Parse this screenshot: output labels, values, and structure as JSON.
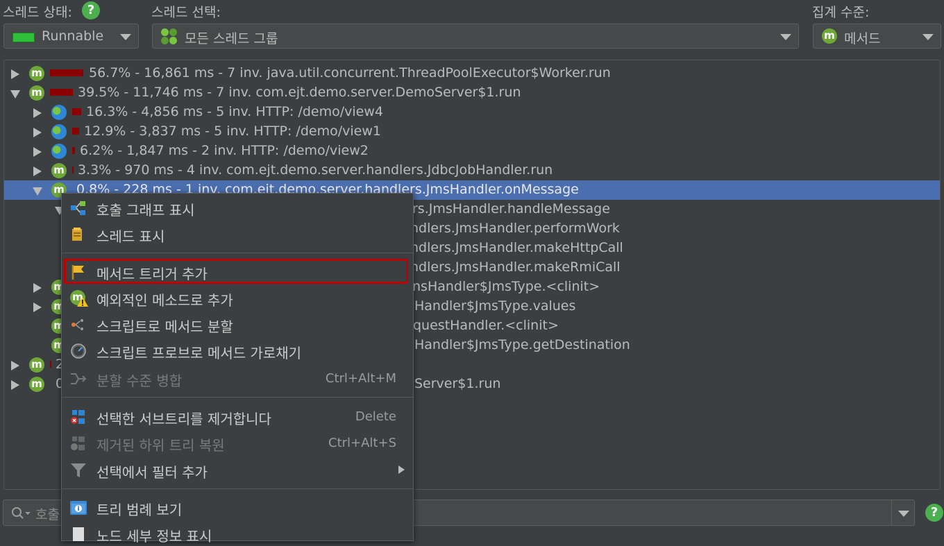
{
  "header": {
    "thread_state_label": "스레드 상태:",
    "thread_state_value": "Runnable",
    "thread_select_label": "스레드 선택:",
    "thread_select_value": "모든 스레드 그룹",
    "aggregation_label": "집계 수준:",
    "aggregation_value": "메서드",
    "help_glyph": "?"
  },
  "colors": {
    "accent_selection": "#4b6eaf",
    "bar": "#8b0000",
    "highlight_border": "#c00000",
    "method_icon": "#6fa839"
  },
  "tree": [
    {
      "text": "56.7% - 16,861 ms - 7 inv. java.util.concurrent.ThreadPoolExecutor$Worker.run",
      "icon": "method-icon",
      "state": "collapsed",
      "share": 0.567
    },
    {
      "text": "39.5% - 11,746 ms - 7 inv. com.ejt.demo.server.DemoServer$1.run",
      "icon": "method-icon",
      "state": "expanded",
      "share": 0.395
    },
    {
      "text": "16.3% - 4,856 ms - 5 inv. HTTP: /demo/view4",
      "icon": "globe-icon",
      "state": "collapsed",
      "share": 0.163
    },
    {
      "text": "12.9% - 3,837 ms - 5 inv. HTTP: /demo/view1",
      "icon": "globe-icon",
      "state": "collapsed",
      "share": 0.129
    },
    {
      "text": "6.2% - 1,847 ms - 2 inv. HTTP: /demo/view2",
      "icon": "globe-icon",
      "state": "collapsed",
      "share": 0.062
    },
    {
      "text": "3.3% - 970 ms - 4 inv. com.ejt.demo.server.handlers.JdbcJobHandler.run",
      "icon": "method-icon",
      "state": "collapsed",
      "share": 0.033
    },
    {
      "text": "0.8% - 228 ms - 1 inv. com.ejt.demo.server.handlers.JmsHandler.onMessage",
      "icon": "method-icon",
      "state": "expanded",
      "share": 0.008
    },
    {
      "text": "rs.JmsHandler.handleMessage",
      "icon": "method-icon",
      "state": "expanded"
    },
    {
      "text": "ndlers.JmsHandler.performWork",
      "icon": "method-icon",
      "state": "none"
    },
    {
      "text": "ndlers.JmsHandler.makeHttpCall",
      "icon": "method-icon",
      "state": "none"
    },
    {
      "text": "ndlers.JmsHandler.makeRmiCall",
      "icon": "method-icon",
      "state": "none"
    },
    {
      "text": "nsHandler$JmsType.<clinit>",
      "icon": "method-icon",
      "state": "collapsed"
    },
    {
      "text": "Handler$JmsType.values",
      "icon": "method-icon",
      "state": "collapsed"
    },
    {
      "text": "questHandler.<clinit>",
      "icon": "method-icon",
      "state": "none"
    },
    {
      "text": "Handler$JmsType.getDestination",
      "icon": "method-icon",
      "state": "none"
    },
    {
      "text": "2",
      "icon": "method-icon",
      "state": "collapsed"
    },
    {
      "text": "0",
      "tail": "Server$1.run",
      "icon": "method-icon",
      "state": "collapsed"
    }
  ],
  "context_menu": [
    {
      "label": "호출 그래프 표시",
      "icon": "call-graph-icon"
    },
    {
      "label": "스레드 표시",
      "icon": "thread-icon"
    },
    {
      "label": "메서드 트리거 추가",
      "icon": "flag-icon",
      "highlighted": true
    },
    {
      "label": "예외적인 메소드로 추가",
      "icon": "method-warning-icon"
    },
    {
      "label": "스크립트로 메서드 분할",
      "icon": "split-icon"
    },
    {
      "label": "스크립트 프로브로 메서드 가로채기",
      "icon": "probe-icon"
    },
    {
      "label": "분할 수준 병합",
      "icon": "merge-icon",
      "shortcut": "Ctrl+Alt+M",
      "disabled": true
    },
    {
      "label": "선택한 서브트리를 제거합니다",
      "icon": "remove-subtree-icon",
      "shortcut": "Delete"
    },
    {
      "label": "제거된 하위 트리 복원",
      "icon": "restore-subtree-icon",
      "shortcut": "Ctrl+Alt+S",
      "disabled": true
    },
    {
      "label": "선택에서 필터 추가",
      "icon": "filter-icon",
      "submenu": true
    },
    {
      "label": "트리 범례 보기",
      "icon": "legend-icon"
    },
    {
      "label": "노드 세부 정보 표시",
      "icon": "node-details-icon"
    }
  ],
  "search": {
    "placeholder": "호출"
  }
}
